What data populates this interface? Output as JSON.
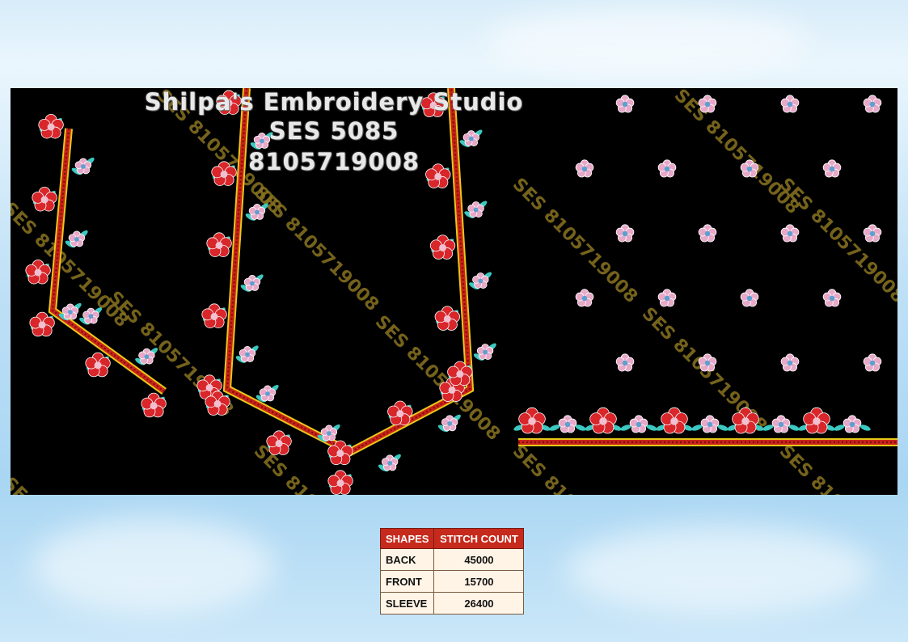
{
  "studio_title": "Shilpa's Embroidery Studio",
  "design_code": "SES 5085",
  "phone": "8105719008",
  "watermark": "SES 8105719008",
  "table": {
    "headers": [
      "SHAPES",
      "STITCH COUNT"
    ],
    "rows": [
      {
        "shape": "BACK",
        "count": "45000"
      },
      {
        "shape": "FRONT",
        "count": "15700"
      },
      {
        "shape": "SLEEVE",
        "count": "26400"
      }
    ]
  },
  "colors": {
    "background": "#000000",
    "border_red": "#c8231a",
    "border_gold": "#e8c81a",
    "flower_red": "#d8262a",
    "flower_pink": "#e8a8c8",
    "leaf_teal": "#3cc8c0",
    "header_red": "#c62a1c"
  }
}
